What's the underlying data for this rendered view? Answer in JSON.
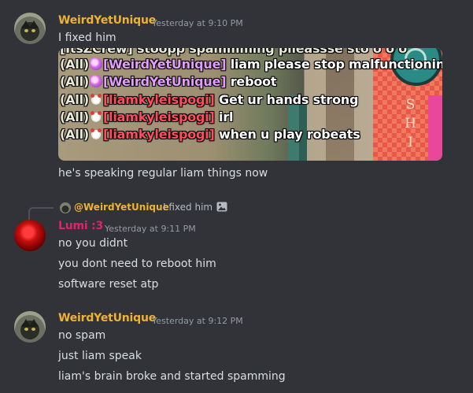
{
  "messages": [
    {
      "author": "WeirdYetUnique",
      "timestamp": "Yesterday at 9:10 PM",
      "lines": [
        "I fixed him",
        "he's speaking regular liam things now"
      ],
      "embed": {
        "partial_line": "[ItsZCrew]  stoopp spammming plleassse sto o o o",
        "chat_lines": [
          {
            "tag": "(All)",
            "name": "[WeirdYetUnique]",
            "text": "liam please stop malfunctioning"
          },
          {
            "tag": "(All)",
            "name": "[WeirdYetUnique]",
            "text": "reboot"
          },
          {
            "tag": "(All)",
            "name": "[liamkyleispogi]",
            "text": "Get ur hands strong"
          },
          {
            "tag": "(All)",
            "name": "[liamkyleispogi]",
            "text": "irl"
          },
          {
            "tag": "(All)",
            "name": "[liamkyleispogi]",
            "text": "when u play robeats"
          }
        ],
        "background_letters": [
          "S",
          "H",
          "I"
        ]
      }
    },
    {
      "author": "Lumi :3",
      "timestamp": "Yesterday at 9:11 PM",
      "reply": {
        "author": "@WeirdYetUnique",
        "text": "I fixed him"
      },
      "lines": [
        "no you didnt",
        "you dont need to reboot him",
        "software reset atp"
      ]
    },
    {
      "author": "WeirdYetUnique",
      "timestamp": "Yesterday at 9:12 PM",
      "lines": [
        "no spam",
        "just liam speak",
        "liam's brain broke and started spamming"
      ]
    }
  ],
  "colors": {
    "background": "#313338",
    "username_weird": "#f0b232",
    "username_lumi": "#e0236b",
    "timestamp": "#949ba4",
    "message_text": "#dbdee1"
  },
  "icons": {
    "reply_attachment": "image-icon",
    "avatar_weird": "cat-avatar",
    "avatar_lumi": "red-orb-avatar"
  }
}
